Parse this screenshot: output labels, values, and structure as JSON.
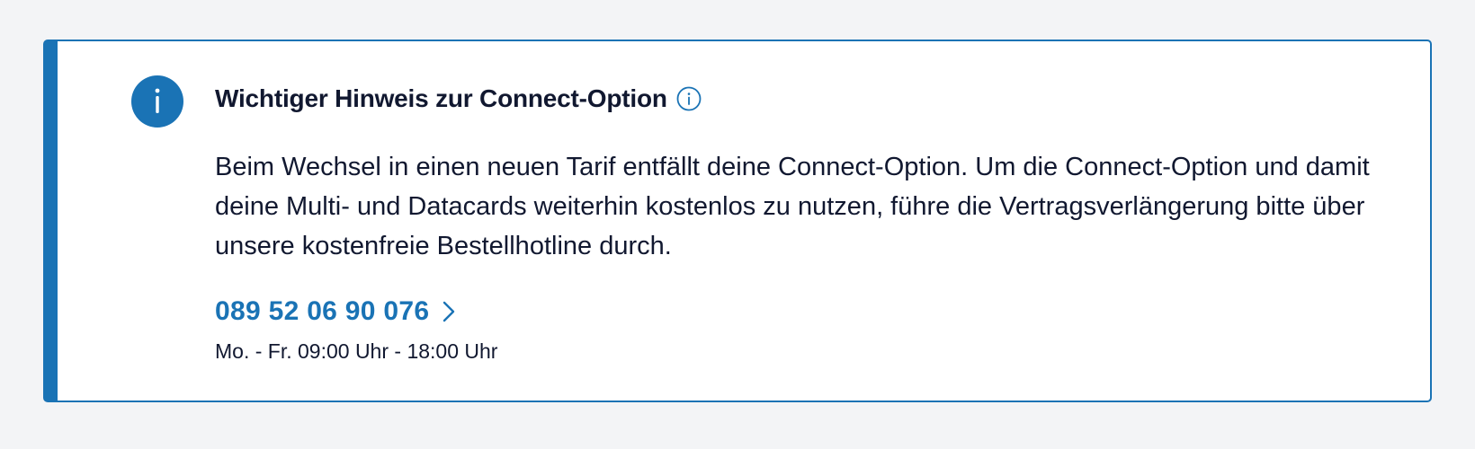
{
  "notice": {
    "title": "Wichtiger Hinweis zur Connect-Option",
    "badge_icon": "info-icon",
    "title_icon": "info-outline-icon",
    "body": "Beim Wechsel in einen neuen Tarif entfällt deine Connect-Option. Um die Connect-Option und damit deine Multi- und Datacards weiterhin kostenlos zu nutzen, führe die Vertragsverlänge­rung bitte über unsere kostenfreie Bestellhotline durch.",
    "phone": {
      "number": "089 52 06 90 076",
      "icon": "chevron-right-icon"
    },
    "hours": "Mo. - Fr. 09:00 Uhr - 18:00 Uhr"
  },
  "colors": {
    "accent": "#1a73b5",
    "text": "#111830",
    "page_background": "#f3f4f6",
    "card_background": "#ffffff"
  }
}
